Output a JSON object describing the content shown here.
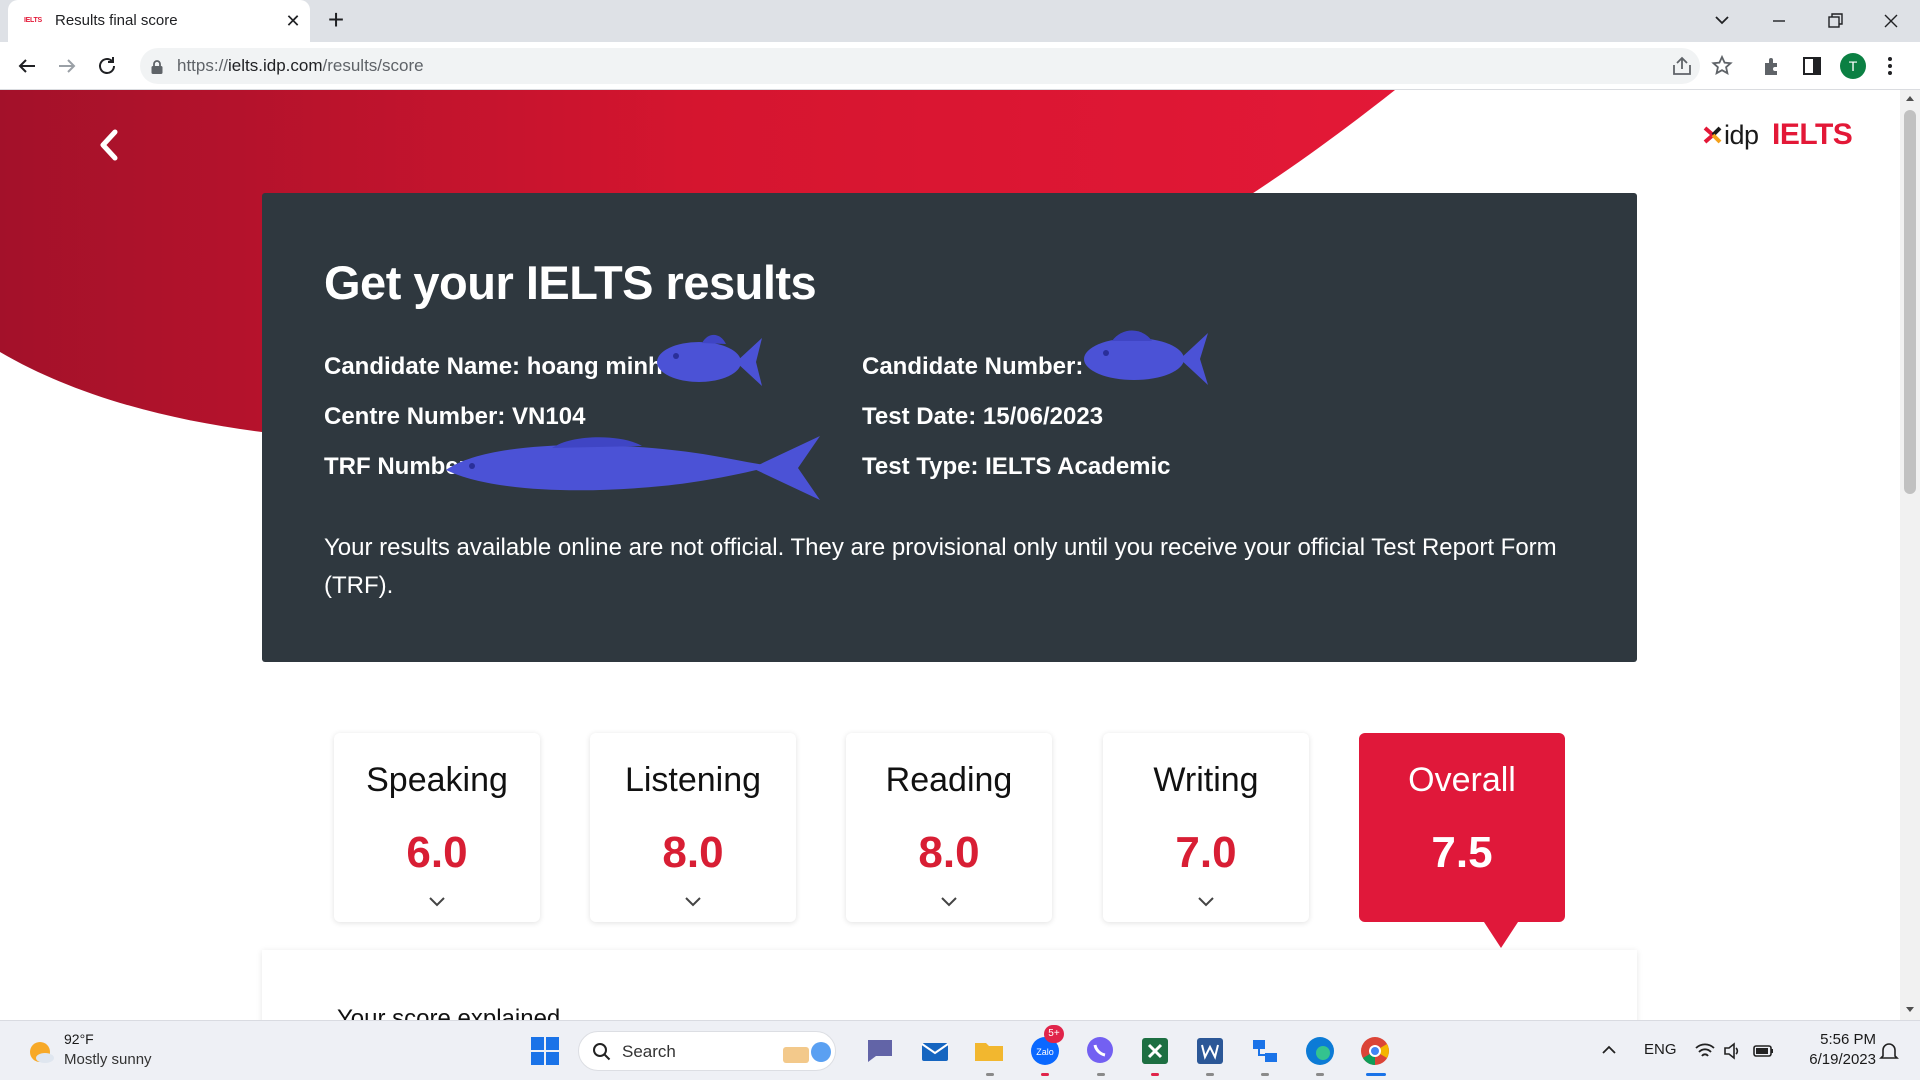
{
  "browser": {
    "tab_title": "Results final score",
    "tab_favicon_text": "IELTS",
    "url_prefix": "https://",
    "url_host": "ielts.idp.com",
    "url_path": "/results/score",
    "profile_initial": "T"
  },
  "header": {
    "logo_idp": "idp",
    "logo_ielts": "IELTS"
  },
  "results": {
    "title": "Get your IELTS results",
    "candidate_name_label": "Candidate Name:",
    "candidate_name_value": "hoang minh",
    "candidate_number_label": "Candidate Number:",
    "candidate_number_value": "",
    "centre_number_label": "Centre Number:",
    "centre_number_value": "VN104",
    "test_date_label": "Test Date:",
    "test_date_value": "15/06/2023",
    "trf_number_label": "TRF Number:",
    "trf_number_value": "",
    "test_type_label": "Test Type:",
    "test_type_value": "IELTS Academic",
    "notice": "Your results available online are not official. They are provisional only until you receive your official Test Report Form (TRF)."
  },
  "scores": [
    {
      "name": "Speaking",
      "value": "6.0"
    },
    {
      "name": "Listening",
      "value": "8.0"
    },
    {
      "name": "Reading",
      "value": "8.0"
    },
    {
      "name": "Writing",
      "value": "7.0"
    },
    {
      "name": "Overall",
      "value": "7.5"
    }
  ],
  "explain": {
    "title": "Your score explained"
  },
  "taskbar": {
    "weather_temp": "92°F",
    "weather_desc": "Mostly sunny",
    "search_label": "Search",
    "zalo_badge": "5+",
    "language": "ENG",
    "time": "5:56 PM",
    "date": "6/19/2023"
  },
  "colors": {
    "brand_red": "#e31837",
    "card_dark": "#2f383f",
    "score_red": "#d81e34"
  }
}
